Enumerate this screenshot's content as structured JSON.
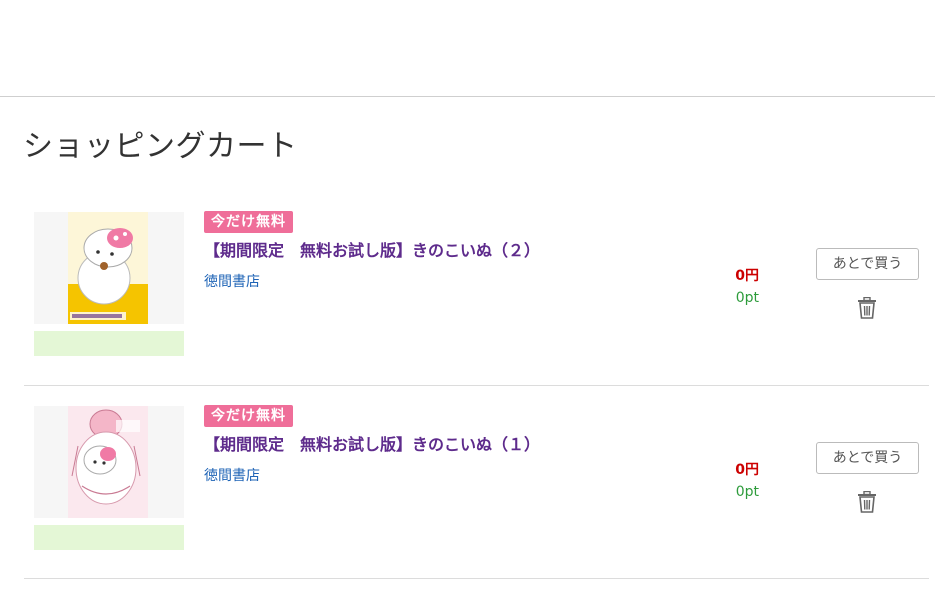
{
  "page": {
    "title": "ショッピングカート"
  },
  "cart": {
    "items": [
      {
        "badge": "今だけ無料",
        "title": "【期間限定　無料お試し版】きのこいぬ（２）",
        "publisher": "徳間書店",
        "price": "0円",
        "points": "0pt",
        "later_label": "あとで買う",
        "cover_icon": "manga-cover-image"
      },
      {
        "badge": "今だけ無料",
        "title": "【期間限定　無料お試し版】きのこいぬ（１）",
        "publisher": "徳間書店",
        "price": "0円",
        "points": "0pt",
        "later_label": "あとで買う",
        "cover_icon": "manga-cover-image"
      }
    ]
  },
  "colors": {
    "badge": "#ef6e99",
    "title": "#5e2b8c",
    "publisher": "#1e63b6",
    "price": "#cc0000",
    "points": "#2e9c3c",
    "green_bar": "#e4f7d6"
  },
  "icons": {
    "delete": "trash-icon"
  }
}
